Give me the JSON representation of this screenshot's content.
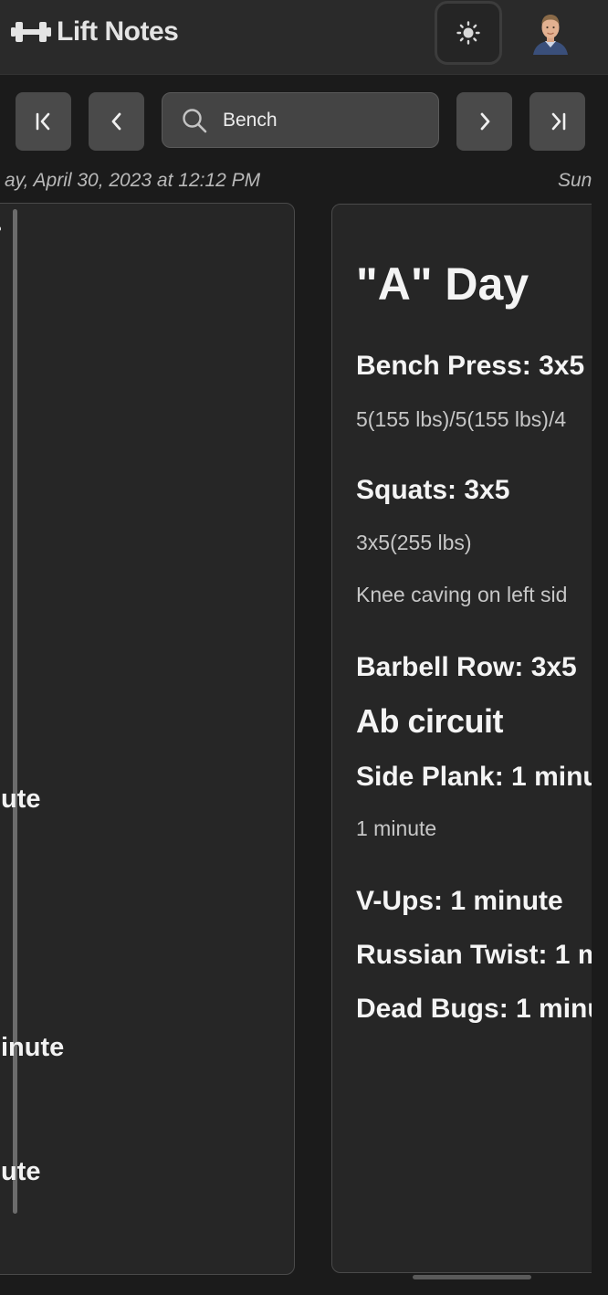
{
  "app": {
    "title": "Lift Notes"
  },
  "search": {
    "value": "Bench"
  },
  "entries": {
    "prev": {
      "date": "ay, April 30, 2023 at 12:12 PM",
      "fragments": [
        "ute",
        "inute",
        "ute"
      ]
    },
    "current": {
      "date": "Sun",
      "title": "\"A\" Day",
      "exercises": [
        {
          "name": "Bench Press: 3x5",
          "notes": [
            "5(155 lbs)/5(155 lbs)/4"
          ]
        },
        {
          "name": "Squats: 3x5",
          "notes": [
            "3x5(255 lbs)",
            "Knee caving on left sid"
          ]
        },
        {
          "name": "Barbell Row: 3x5"
        }
      ],
      "section": "Ab circuit",
      "ab_exercises": [
        {
          "name": "Side Plank: 1 minu",
          "notes": [
            "1 minute"
          ]
        },
        {
          "name": "V-Ups: 1 minute"
        },
        {
          "name": "Russian Twist: 1 m"
        },
        {
          "name": "Dead Bugs: 1 minu"
        }
      ]
    }
  },
  "icons": {
    "logo": "dumbbell-icon",
    "theme": "sun-icon",
    "first": "skip-to-first-icon",
    "prev": "chevron-left-icon",
    "search": "search-icon",
    "next": "chevron-right-icon",
    "last": "skip-to-last-icon",
    "delete": "trash-icon"
  },
  "colors": {
    "background": "#1b1b1b",
    "header": "#2a2a2a",
    "card": "#262626",
    "button": "#4a4a4a"
  }
}
